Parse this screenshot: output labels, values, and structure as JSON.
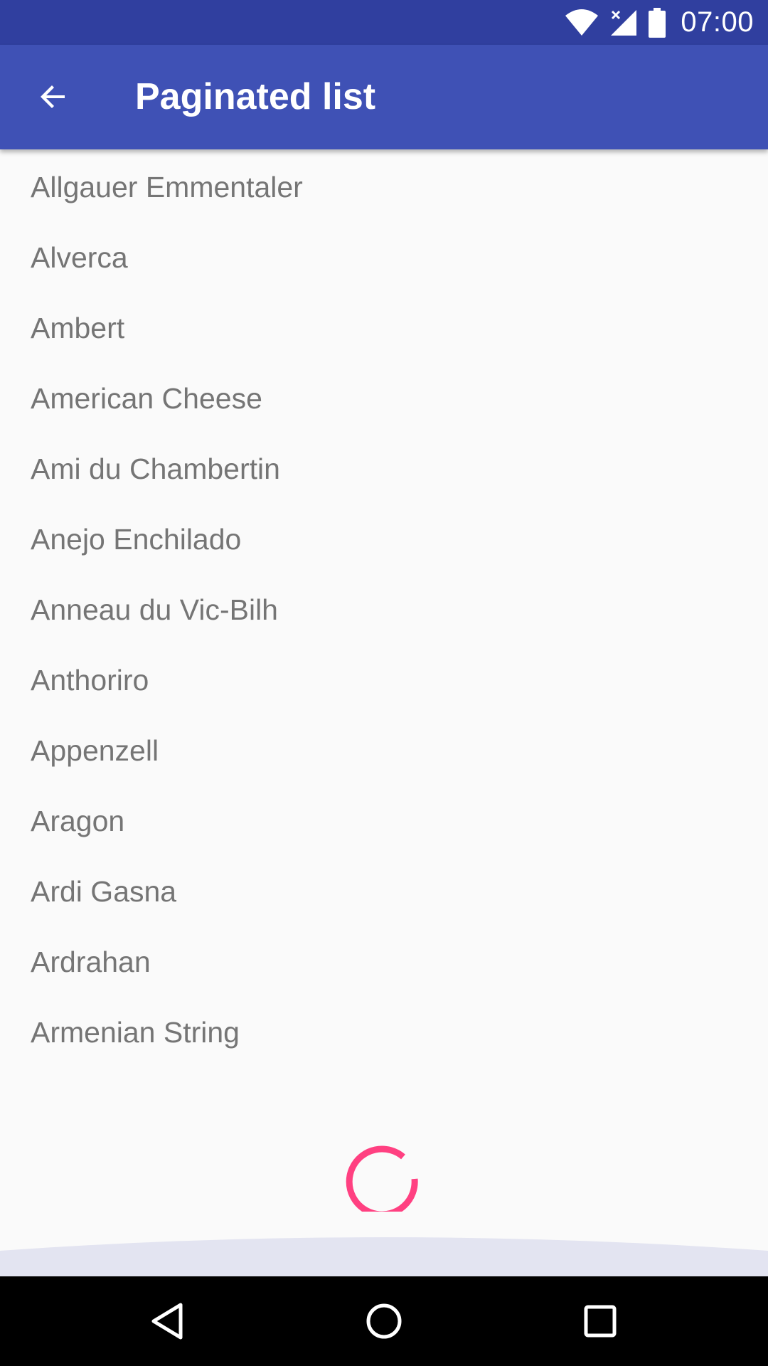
{
  "status_bar": {
    "time": "07:00",
    "icons": [
      "wifi-icon",
      "signal-icon",
      "battery-icon"
    ]
  },
  "app_bar": {
    "title": "Paginated list",
    "back_icon": "arrow-back-icon",
    "background": "#3f51b5",
    "status_background": "#303f9f"
  },
  "list": {
    "items": [
      "Allgauer Emmentaler",
      "Alverca",
      "Ambert",
      "American Cheese",
      "Ami du Chambertin",
      "Anejo Enchilado",
      "Anneau du Vic-Bilh",
      "Anthoriro",
      "Appenzell",
      "Aragon",
      "Ardi Gasna",
      "Ardrahan",
      "Armenian String"
    ]
  },
  "loading": {
    "spinner_color": "#ff4081"
  },
  "nav_bar": {
    "buttons": [
      "back-triangle-icon",
      "home-circle-icon",
      "recents-square-icon"
    ]
  }
}
